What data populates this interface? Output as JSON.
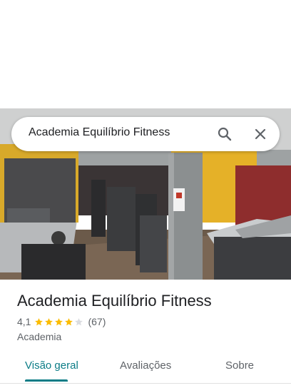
{
  "search": {
    "value": "Academia Equilíbrio Fitness"
  },
  "place": {
    "name": "Academia Equilíbrio Fitness",
    "rating": "4,1",
    "stars": 4.1,
    "reviews": "(67)",
    "category": "Academia"
  },
  "tabs": [
    {
      "label": "Visão geral",
      "active": true
    },
    {
      "label": "Avaliações",
      "active": false
    },
    {
      "label": "Sobre",
      "active": false
    }
  ],
  "colors": {
    "accent": "#0b7c86",
    "star": "#fbbc04",
    "star_empty": "#dadce0",
    "wall_yellow": "#e5b128",
    "wall_red": "#8e2d2d"
  },
  "icons": {
    "search": "search-icon",
    "close": "close-icon"
  }
}
